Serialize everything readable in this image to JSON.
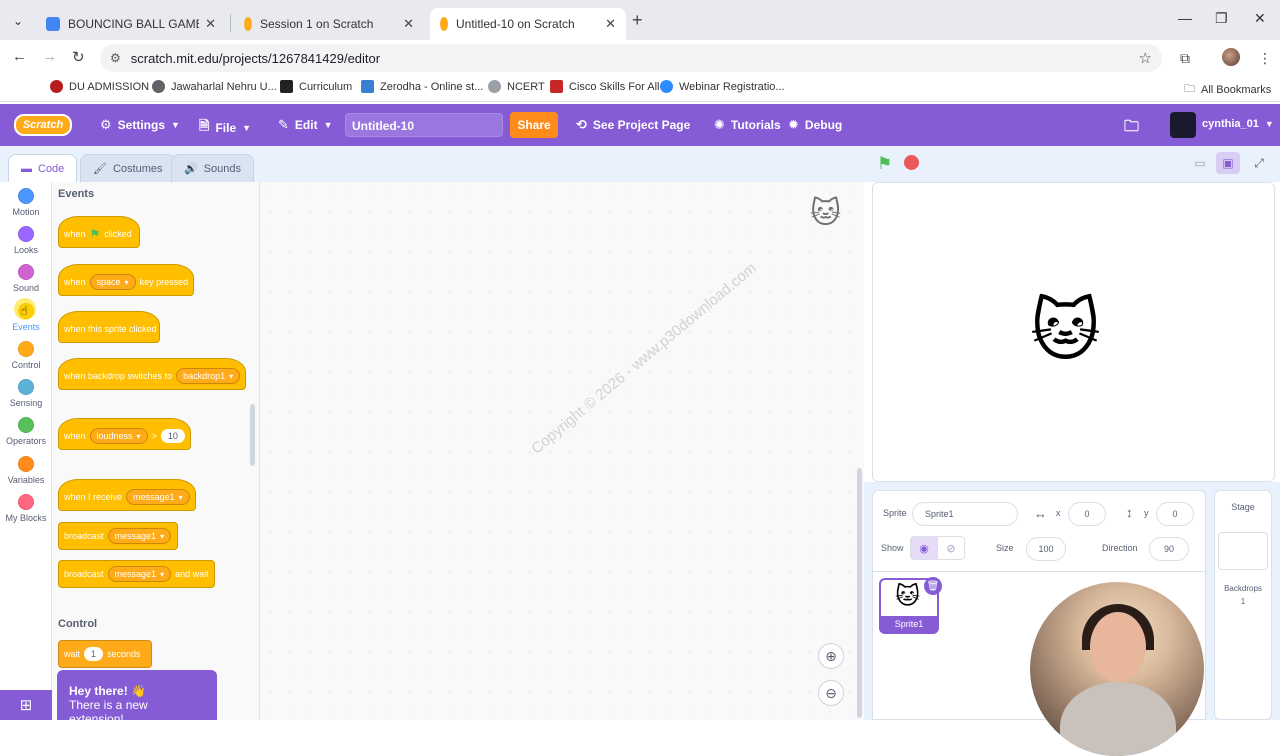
{
  "browser": {
    "tabs": [
      {
        "title": "BOUNCING BALL GAME - Prese",
        "close": "✕",
        "fav_color": "#4285f4"
      },
      {
        "title": "Session 1 on Scratch",
        "close": "✕",
        "fav_color": "#ffab19"
      },
      {
        "title": "Untitled-10 on Scratch",
        "close": "✕",
        "fav_color": "#ffab19"
      }
    ],
    "url": "scratch.mit.edu/projects/1267841429/editor",
    "bookmarks": [
      {
        "label": "DU ADMISSION",
        "color": "#b71c1c"
      },
      {
        "label": "Jawaharlal Nehru U...",
        "color": "#5f6368"
      },
      {
        "label": "Curriculum",
        "color": "#222"
      },
      {
        "label": "Zerodha - Online st...",
        "color": "#387ed1"
      },
      {
        "label": "NCERT",
        "color": "#9aa0a6"
      },
      {
        "label": "Cisco Skills For All",
        "color": "#c62828"
      },
      {
        "label": "Webinar Registratio...",
        "color": "#2d8cff"
      }
    ],
    "all_bookmarks": "All Bookmarks"
  },
  "menubar": {
    "logo": "Scratch",
    "settings": "Settings",
    "file": "File",
    "edit": "Edit",
    "project_title": "Untitled-10",
    "share": "Share",
    "see_project": "See Project Page",
    "tutorials": "Tutorials",
    "debug": "Debug",
    "username": "cynthia_01"
  },
  "editor_tabs": {
    "code": "Code",
    "costumes": "Costumes",
    "sounds": "Sounds"
  },
  "categories": [
    {
      "label": "Motion",
      "color": "#4c97ff"
    },
    {
      "label": "Looks",
      "color": "#9966ff"
    },
    {
      "label": "Sound",
      "color": "#cf63cf"
    },
    {
      "label": "Events",
      "color": "#ffbf00"
    },
    {
      "label": "Control",
      "color": "#ffab19"
    },
    {
      "label": "Sensing",
      "color": "#5cb1d6"
    },
    {
      "label": "Operators",
      "color": "#59c059"
    },
    {
      "label": "Variables",
      "color": "#ff8c1a"
    },
    {
      "label": "My Blocks",
      "color": "#ff6680"
    }
  ],
  "palette": {
    "events_title": "Events",
    "when_flag": {
      "when": "when",
      "clicked": "clicked"
    },
    "when_key": {
      "when": "when",
      "key": "space",
      "pressed": "key pressed"
    },
    "sprite_clicked": "when this sprite clicked",
    "backdrop": {
      "text": "when backdrop switches to",
      "value": "backdrop1"
    },
    "loudness": {
      "when": "when",
      "var": "loudness",
      "op": ">",
      "value": "10"
    },
    "receive": {
      "text": "when I receive",
      "value": "message1"
    },
    "broadcast": {
      "text": "broadcast",
      "value": "message1"
    },
    "broadcast_wait": {
      "text": "broadcast",
      "value": "message1",
      "suffix": "and wait"
    },
    "control_title": "Control",
    "wait": {
      "text": "wait",
      "value": "1",
      "suffix": "seconds"
    }
  },
  "toast": {
    "line1": "Hey there! 👋",
    "line2": "There is a new extension!"
  },
  "watermark": "Copyright © 2026 - www.p30download.com",
  "sprite_info": {
    "sprite_label": "Sprite",
    "sprite_name": "Sprite1",
    "x_label": "x",
    "x": "0",
    "y_label": "y",
    "y": "0",
    "show_label": "Show",
    "size_label": "Size",
    "size": "100",
    "direction_label": "Direction",
    "direction": "90"
  },
  "sprite_tile": {
    "name": "Sprite1"
  },
  "stage_panel": {
    "title": "Stage",
    "backdrops_label": "Backdrops",
    "backdrops_count": "1"
  }
}
